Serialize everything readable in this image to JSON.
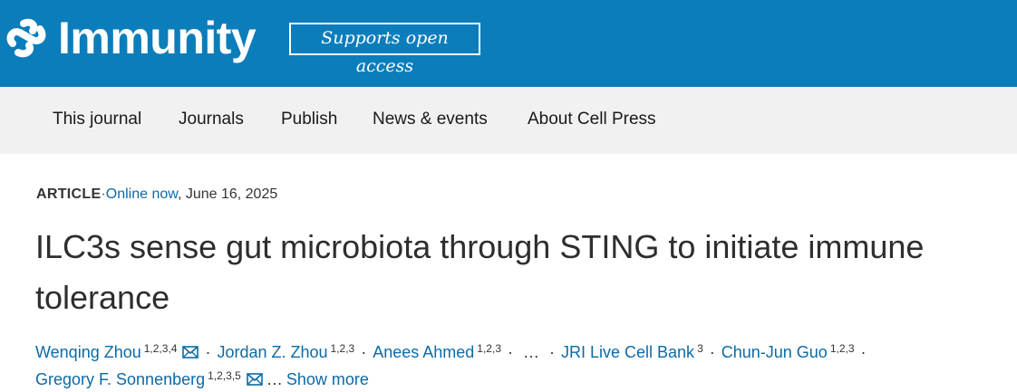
{
  "header": {
    "brand": "Immunity",
    "badge": "Supports open access",
    "background_color": "#0c7dbb",
    "logo_icon": "cell-press-logo-icon"
  },
  "nav": {
    "items": [
      "This journal",
      "Journals",
      "Publish",
      "News & events",
      "About Cell Press"
    ]
  },
  "article": {
    "type": "ARTICLE",
    "separator": "·",
    "status": "Online now",
    "date": ", June 16, 2025",
    "title_line1": "ILC3s sense gut microbiota through STING to initiate immune",
    "title_line2": "tolerance",
    "authors": [
      {
        "name": "Wenqing Zhou",
        "aff": "1,2,3,4",
        "email_icon": "envelope-icon"
      },
      {
        "name": "Jordan Z. Zhou",
        "aff": "1,2,3"
      },
      {
        "name": "Anees Ahmed",
        "aff": "1,2,3"
      },
      {
        "name": "JRI Live Cell Bank",
        "aff": "3"
      },
      {
        "name": "Chun-Jun Guo",
        "aff": "1,2,3"
      },
      {
        "name": "Gregory F. Sonnenberg",
        "aff": "1,2,3,5",
        "email_icon": "envelope-icon"
      }
    ],
    "ellipsis": "…",
    "show_more": "Show more",
    "link_color": "#0c6aa6"
  }
}
